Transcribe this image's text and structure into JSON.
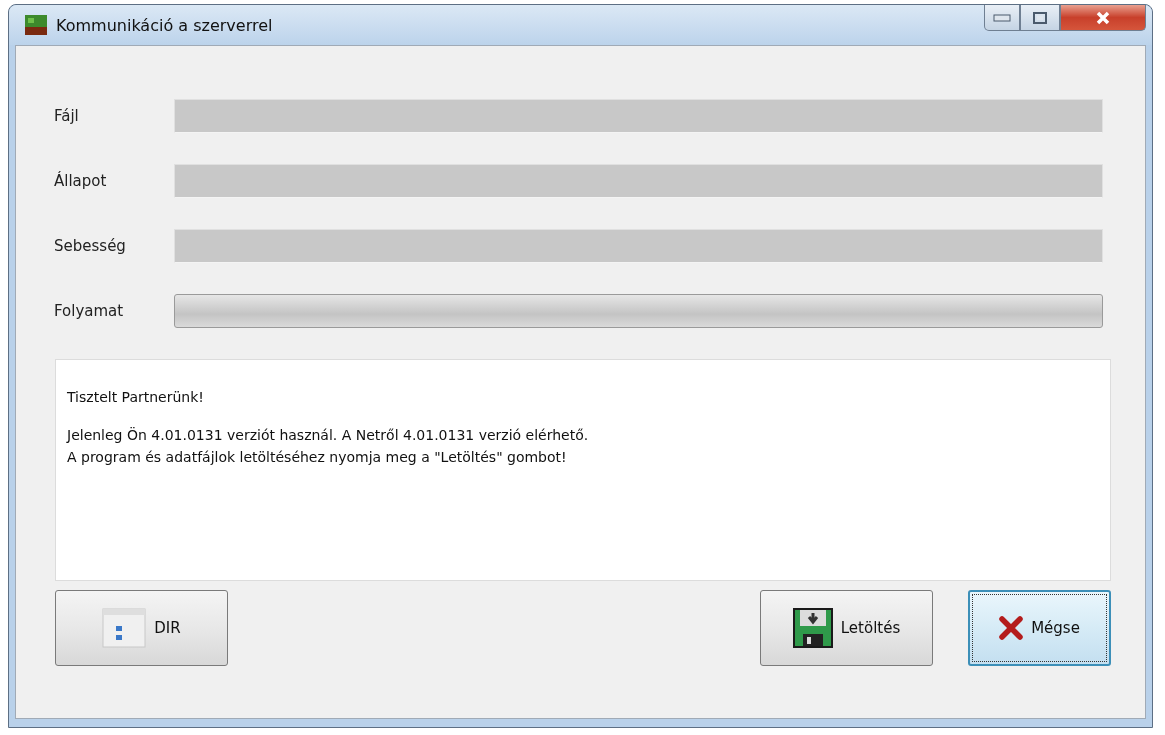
{
  "window": {
    "title": "Kommunikáció a szerverrel"
  },
  "fields": [
    {
      "label": "Fájl",
      "kind": "text"
    },
    {
      "label": "Állapot",
      "kind": "text"
    },
    {
      "label": "Sebesség",
      "kind": "text"
    },
    {
      "label": "Folyamat",
      "kind": "progress",
      "level": 0
    }
  ],
  "message": [
    "Tisztelt Partnerünk!",
    "Jelenleg Ön 4.01.0131 verziót használ. A Netről 4.01.0131 verzió elérhető.",
    "A program és adatfájlok letöltéséhez nyomja meg a \"Letöltés\" gombot!"
  ],
  "buttons": [
    {
      "label": "DIR",
      "focused": false
    },
    {
      "label": "Letöltés",
      "focused": false
    },
    {
      "label": "Mégse",
      "focused": true
    }
  ]
}
